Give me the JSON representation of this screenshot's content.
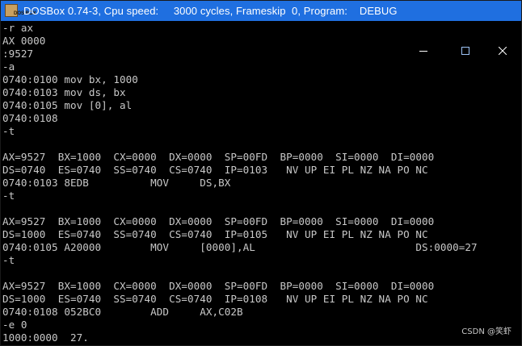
{
  "window": {
    "title": "DOSBox 0.74-3, Cpu speed:     3000 cycles, Frameskip  0, Program:    DEBUG",
    "icon_text": "DOS BOX",
    "controls": [
      "minimize-icon",
      "maximize-icon",
      "close-icon"
    ],
    "titlebar_color": "#1f6fe0",
    "console_background": "#000000",
    "console_text_color": "#c8c8c8"
  },
  "console": {
    "lines": [
      "-r ax",
      "AX 0000",
      ":9527",
      "-a",
      "0740:0100 mov bx, 1000",
      "0740:0103 mov ds, bx",
      "0740:0105 mov [0], al",
      "0740:0108",
      "-t",
      "",
      "AX=9527  BX=1000  CX=0000  DX=0000  SP=00FD  BP=0000  SI=0000  DI=0000",
      "DS=0740  ES=0740  SS=0740  CS=0740  IP=0103   NV UP EI PL NZ NA PO NC",
      "0740:0103 8EDB          MOV     DS,BX",
      "-t",
      "",
      "AX=9527  BX=1000  CX=0000  DX=0000  SP=00FD  BP=0000  SI=0000  DI=0000",
      "DS=1000  ES=0740  SS=0740  CS=0740  IP=0105   NV UP EI PL NZ NA PO NC",
      "0740:0105 A20000        MOV     [0000],AL                          DS:0000=27",
      "-t",
      "",
      "AX=9527  BX=1000  CX=0000  DX=0000  SP=00FD  BP=0000  SI=0000  DI=0000",
      "DS=1000  ES=0740  SS=0740  CS=0740  IP=0108   NV UP EI PL NZ NA PO NC",
      "0740:0108 052BC0        ADD     AX,C02B",
      "-e 0",
      "1000:0000  27."
    ]
  },
  "watermark": "CSDN @笑虾"
}
